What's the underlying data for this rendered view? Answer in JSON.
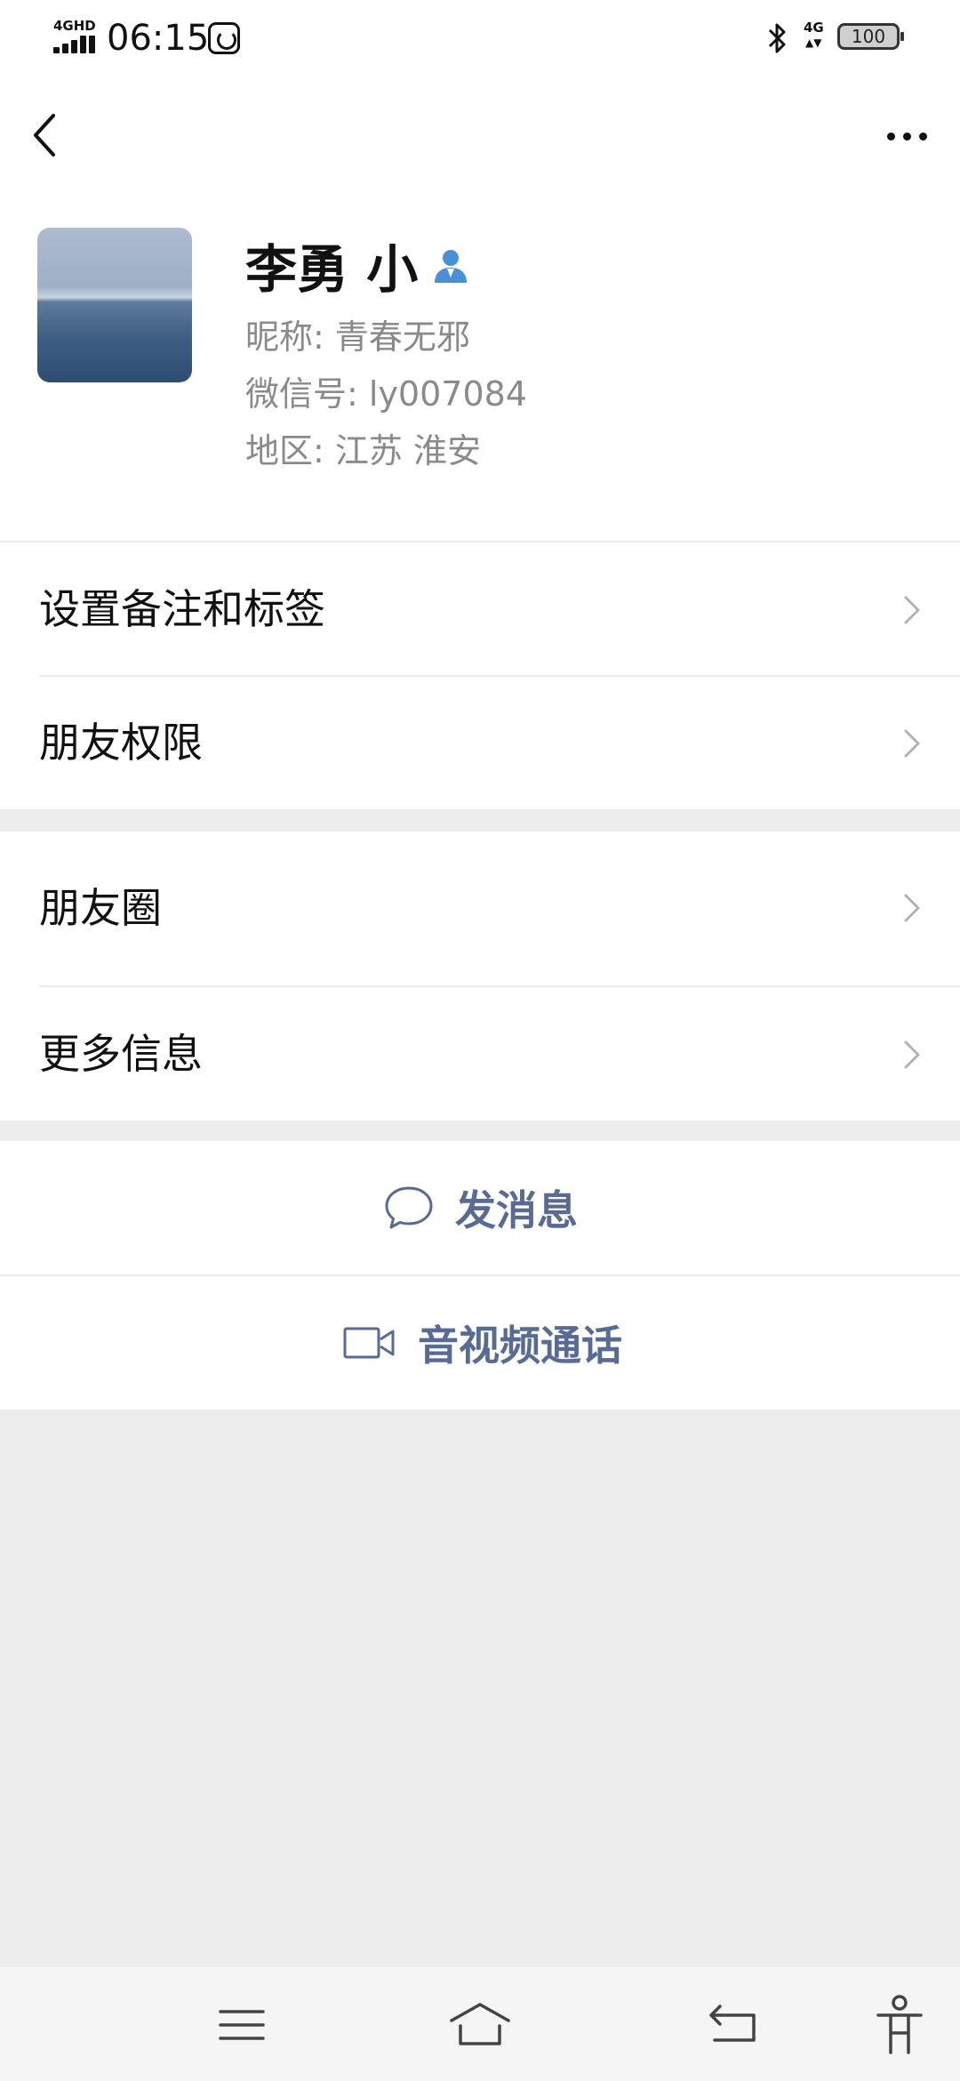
{
  "status_bar": {
    "network_label": "4GHD",
    "time": "06:15",
    "net_right": "4G",
    "net_right_arrows": "▲▼",
    "battery": "100"
  },
  "profile": {
    "name": "李勇 小",
    "nickname": "昵称:  青春无邪",
    "wechat_id": "微信号:  ly007084",
    "region": "地区:  江苏  淮安"
  },
  "menu_group_1": [
    {
      "label": "设置备注和标签"
    },
    {
      "label": "朋友权限"
    }
  ],
  "menu_group_2": [
    {
      "label": "朋友圈"
    },
    {
      "label": "更多信息"
    }
  ],
  "actions": {
    "send_message": "发消息",
    "video_call": "音视频通话"
  },
  "colors": {
    "accent": "#576b95",
    "verify_icon": "#4a90d9",
    "background": "#ededed"
  },
  "icons": {
    "back": "chevron-left-icon",
    "more": "more-dots-icon",
    "verify": "person-icon",
    "chat": "chat-bubble-icon",
    "video": "video-camera-icon",
    "menu": "menu-icon",
    "home": "home-icon",
    "back_nav": "return-icon",
    "accessibility": "accessibility-icon"
  }
}
